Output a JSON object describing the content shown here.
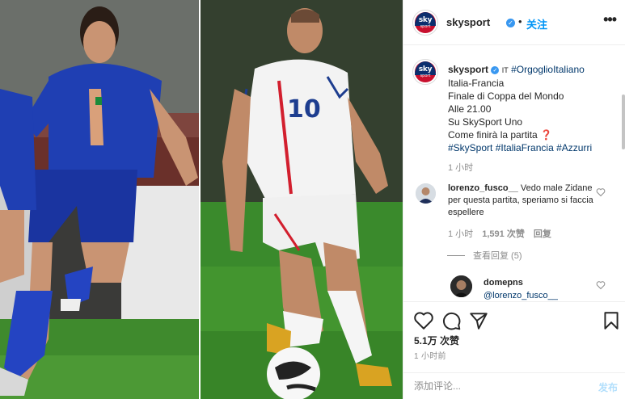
{
  "post": {
    "account": "skysport",
    "follow_label": "关注",
    "dot": "•",
    "more_label": "•••",
    "avatar_word": "sky",
    "avatar_sub": "sport",
    "verified_glyph": "✓"
  },
  "caption": {
    "username": "skysport",
    "flag_badge": "IT",
    "lines": [
      "Italia-Francia",
      "Finale di Coppa del Mondo",
      "Alle 21.00",
      "Su SkySport Uno"
    ],
    "hashtag_first": "#OrgoglioItaliano",
    "question": "Come finirà la partita",
    "question_mark": "❓",
    "hashtags": [
      "#SkySport",
      "#ItaliaFrancia",
      "#Azzurri"
    ],
    "time": "1 小时"
  },
  "comments": [
    {
      "username": "lorenzo_fusco__",
      "text": "Vedo male Zidane per questa partita, speriamo si faccia espellere",
      "time": "1 小时",
      "likes": "1,591 次赞",
      "reply_label": "回复",
      "view_replies": "查看回复 (5)"
    },
    {
      "username": "domepns",
      "text": "@lorenzo_fusco__"
    }
  ],
  "actions": {
    "icons": [
      "heart-icon",
      "comment-icon",
      "share-icon",
      "bookmark-icon"
    ]
  },
  "stats": {
    "likes": "5.1万 次赞",
    "posted": "1 小时前"
  },
  "add_comment": {
    "placeholder": "添加评论...",
    "post_label": "发布"
  },
  "photo": {
    "left_player_number": "",
    "right_player_number": "10"
  },
  "colors": {
    "link_blue": "#0095f6",
    "verified": "#3897f0",
    "italy_blue": "#1f3fb3",
    "france_white": "#f3f3f3",
    "pitch": "#3f8a2d"
  }
}
